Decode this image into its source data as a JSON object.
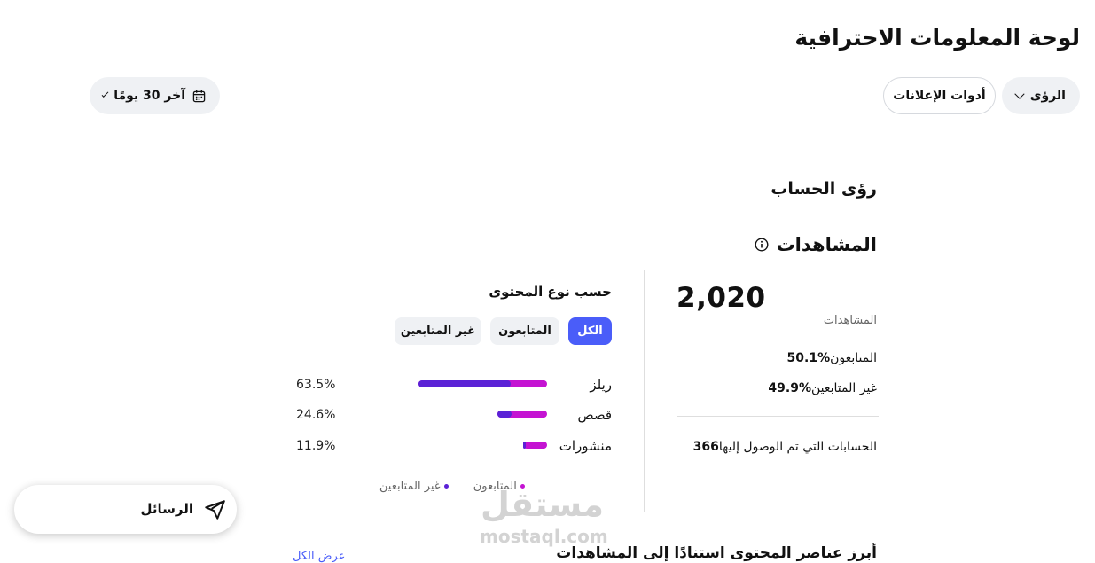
{
  "header": {
    "title": "لوحة المعلومات الاحترافية",
    "insights_label": "الرؤى",
    "ads_tools_label": "أدوات الإعلانات",
    "date_range_label": "آخر 30 يومًا"
  },
  "account": {
    "section_title": "رؤى الحساب",
    "views_title": "المشاهدات"
  },
  "stats": {
    "total_views": "2,020",
    "total_views_label": "المشاهدات",
    "followers_label": "المتابعون",
    "followers_value": "%50.1",
    "non_followers_label": "غير المتابعين",
    "non_followers_value": "%49.9",
    "accounts_reached_label": "الحسابات التي تم الوصول إليها",
    "accounts_reached_value": "366"
  },
  "content_type": {
    "title": "حسب نوع المحتوى",
    "tabs": [
      "الكل",
      "المتابعون",
      "غير المتابعين"
    ],
    "selected_tab": "الكل",
    "rows": [
      {
        "label": "ريلز",
        "percent_text": "63.5%",
        "share": 0.635,
        "followers_fraction": 0.72
      },
      {
        "label": "قصص",
        "percent_text": "24.6%",
        "share": 0.246,
        "followers_fraction": 0.28
      },
      {
        "label": "منشورات",
        "percent_text": "11.9%",
        "share": 0.119,
        "followers_fraction": 0.1
      }
    ],
    "legend": {
      "followers": "المتابعون",
      "non_followers": "غير المتابعين"
    }
  },
  "top_content": {
    "title": "أبرز عناصر المحتوى استنادًا إلى المشاهدات",
    "view_all": "عرض الكل"
  },
  "messages": {
    "label": "الرسائل"
  },
  "watermark": {
    "arabic": "مستقل",
    "latin": "mostaql.com"
  },
  "colors": {
    "accent": "#4a5df9",
    "followers": "#5b22d6",
    "non_followers": "#c413d2"
  }
}
